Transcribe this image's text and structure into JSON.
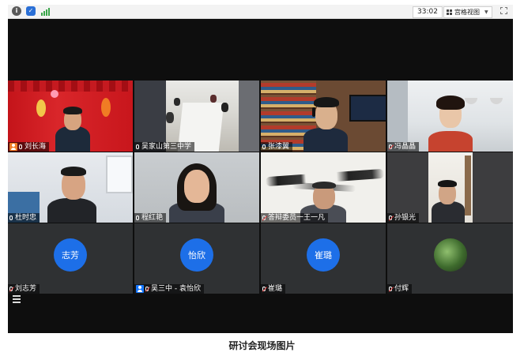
{
  "toolbar": {
    "info_icon": "info-icon",
    "shield_icon": "shield-icon",
    "signal_icon": "signal-icon",
    "timer": "33:02",
    "view_mode_label": "宫格视图",
    "fullscreen_icon": "fullscreen-icon"
  },
  "participants": [
    {
      "name": "刘长海",
      "mic": "on",
      "host_icon": true,
      "video": true
    },
    {
      "name": "吴家山第三中学",
      "mic": "on",
      "video": true
    },
    {
      "name": "张漆翼",
      "mic": "on",
      "video": true
    },
    {
      "name": "冯晶晶",
      "mic": "muted",
      "video": true
    },
    {
      "name": "杜时忠",
      "mic": "on",
      "video": true
    },
    {
      "name": "程红艳",
      "mic": "on",
      "video": true
    },
    {
      "name": "答辩委员一王一凡",
      "mic": "muted",
      "video": true
    },
    {
      "name": "孙银光",
      "mic": "muted",
      "video": true
    },
    {
      "name": "刘志芳",
      "mic": "muted",
      "video": false,
      "avatar_text": "志芳"
    },
    {
      "name": "吴三中 - 袁怡欣",
      "mic": "muted",
      "host_icon": true,
      "video": false,
      "avatar_text": "怡欣"
    },
    {
      "name": "崔璐",
      "mic": "muted",
      "video": false,
      "avatar_text": "崔璐"
    },
    {
      "name": "付辉",
      "mic": "muted",
      "video": false,
      "avatar_text": ""
    }
  ],
  "caption": "研讨会现场图片",
  "colors": {
    "avatar_blue": "#1d6fe8",
    "tile_bg": "#2f3133",
    "app_bg": "#0e0e0e"
  }
}
